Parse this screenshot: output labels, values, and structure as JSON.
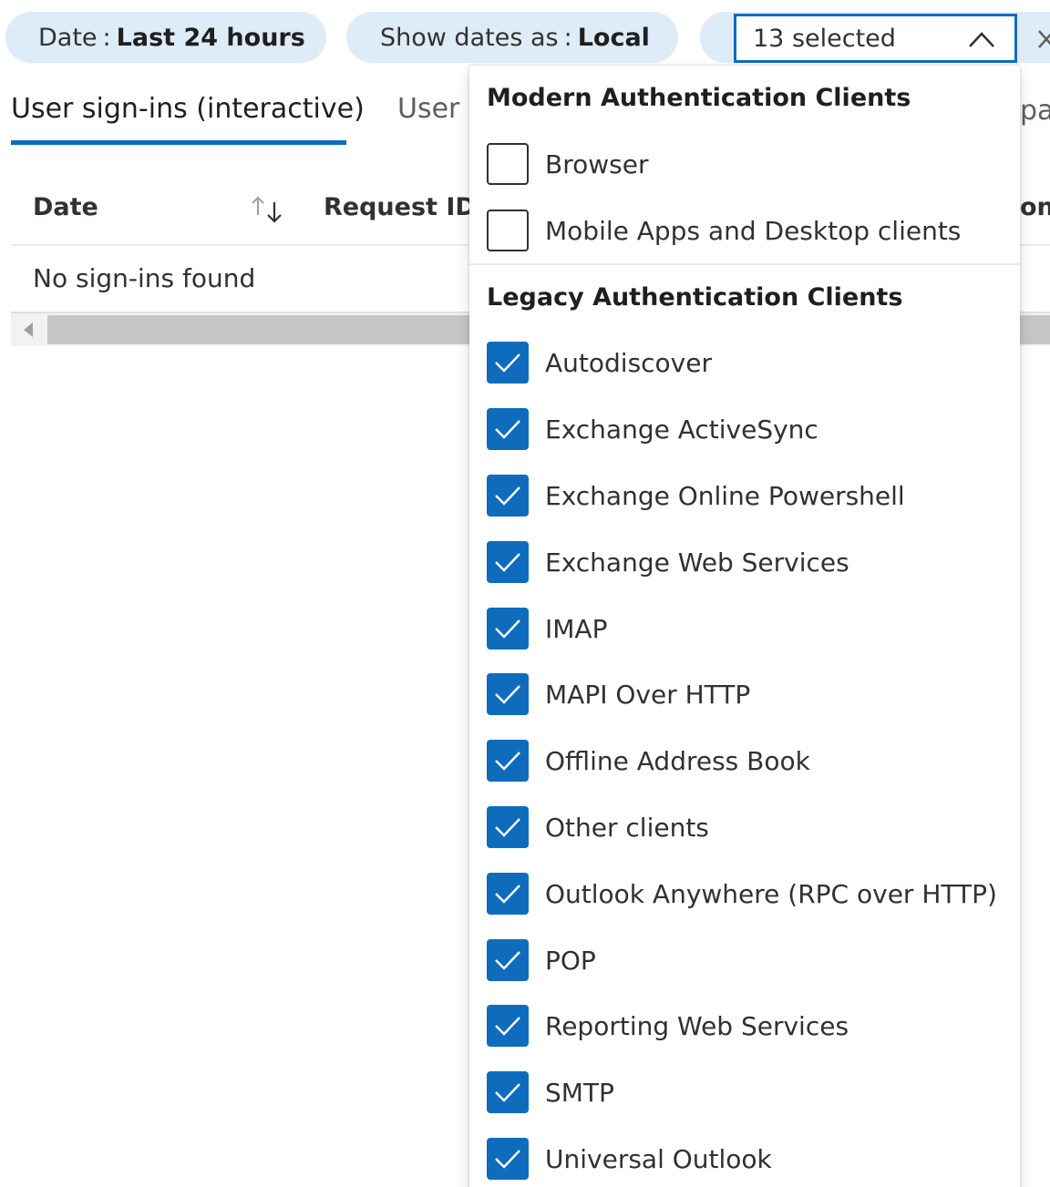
{
  "filters": {
    "date": {
      "label": "Date",
      "separator": ":",
      "value": "Last 24 hours"
    },
    "show_dates": {
      "label": "Show dates as",
      "separator": ":",
      "value": "Local"
    },
    "client_app": {
      "selected_text": "13 selected"
    }
  },
  "tabs": [
    {
      "label": "User sign-ins (interactive)",
      "active": true
    },
    {
      "label": "User s",
      "active": false
    },
    {
      "label": "pal",
      "active": false
    }
  ],
  "table": {
    "columns": [
      "Date",
      "Request ID",
      "on"
    ],
    "empty_message": "No sign-ins found"
  },
  "dropdown": {
    "groups": [
      {
        "header": "Modern Authentication Clients",
        "options": [
          {
            "label": "Browser",
            "checked": false
          },
          {
            "label": "Mobile Apps and Desktop clients",
            "checked": false
          }
        ]
      },
      {
        "header": "Legacy Authentication Clients",
        "options": [
          {
            "label": "Autodiscover",
            "checked": true
          },
          {
            "label": "Exchange ActiveSync",
            "checked": true
          },
          {
            "label": "Exchange Online Powershell",
            "checked": true
          },
          {
            "label": "Exchange Web Services",
            "checked": true
          },
          {
            "label": "IMAP",
            "checked": true
          },
          {
            "label": "MAPI Over HTTP",
            "checked": true
          },
          {
            "label": "Offline Address Book",
            "checked": true
          },
          {
            "label": "Other clients",
            "checked": true
          },
          {
            "label": "Outlook Anywhere (RPC over HTTP)",
            "checked": true
          },
          {
            "label": "POP",
            "checked": true
          },
          {
            "label": "Reporting Web Services",
            "checked": true
          },
          {
            "label": "SMTP",
            "checked": true
          },
          {
            "label": "Universal Outlook",
            "checked": true
          }
        ]
      }
    ]
  },
  "colors": {
    "accent": "#0f6cbd",
    "pill_bg": "#deecf9",
    "text": "#323130"
  },
  "icons": [
    "chevron-up-icon",
    "close-icon",
    "sort-icon",
    "chevron-left-icon",
    "checkmark-icon"
  ]
}
